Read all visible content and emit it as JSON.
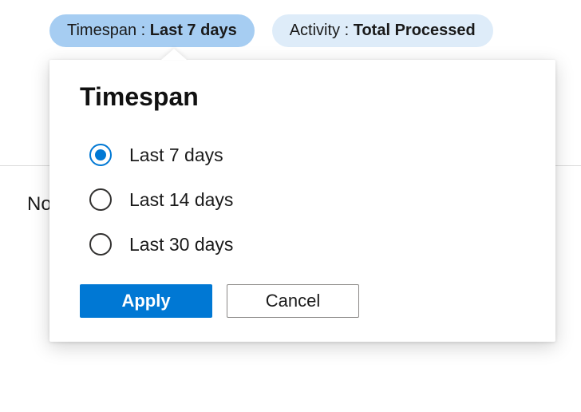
{
  "pills": {
    "timespan": {
      "label": "Timespan : ",
      "value": "Last 7 days"
    },
    "activity": {
      "label": "Activity : ",
      "value": "Total Processed"
    }
  },
  "background": {
    "partial_text": "No"
  },
  "popover": {
    "title": "Timespan",
    "options": [
      {
        "label": "Last 7 days",
        "selected": true
      },
      {
        "label": "Last 14 days",
        "selected": false
      },
      {
        "label": "Last 30 days",
        "selected": false
      }
    ],
    "buttons": {
      "apply": "Apply",
      "cancel": "Cancel"
    }
  }
}
